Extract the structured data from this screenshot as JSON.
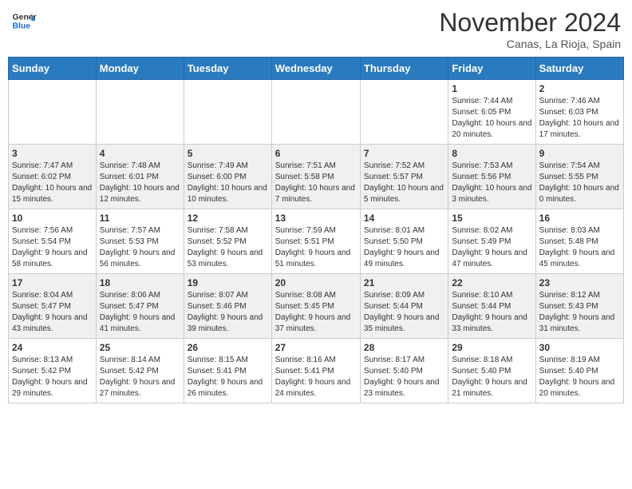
{
  "header": {
    "logo_line1": "General",
    "logo_line2": "Blue",
    "month_title": "November 2024",
    "location": "Canas, La Rioja, Spain"
  },
  "days_of_week": [
    "Sunday",
    "Monday",
    "Tuesday",
    "Wednesday",
    "Thursday",
    "Friday",
    "Saturday"
  ],
  "weeks": [
    [
      {
        "day": "",
        "info": ""
      },
      {
        "day": "",
        "info": ""
      },
      {
        "day": "",
        "info": ""
      },
      {
        "day": "",
        "info": ""
      },
      {
        "day": "",
        "info": ""
      },
      {
        "day": "1",
        "info": "Sunrise: 7:44 AM\nSunset: 6:05 PM\nDaylight: 10 hours and 20 minutes."
      },
      {
        "day": "2",
        "info": "Sunrise: 7:46 AM\nSunset: 6:03 PM\nDaylight: 10 hours and 17 minutes."
      }
    ],
    [
      {
        "day": "3",
        "info": "Sunrise: 7:47 AM\nSunset: 6:02 PM\nDaylight: 10 hours and 15 minutes."
      },
      {
        "day": "4",
        "info": "Sunrise: 7:48 AM\nSunset: 6:01 PM\nDaylight: 10 hours and 12 minutes."
      },
      {
        "day": "5",
        "info": "Sunrise: 7:49 AM\nSunset: 6:00 PM\nDaylight: 10 hours and 10 minutes."
      },
      {
        "day": "6",
        "info": "Sunrise: 7:51 AM\nSunset: 5:58 PM\nDaylight: 10 hours and 7 minutes."
      },
      {
        "day": "7",
        "info": "Sunrise: 7:52 AM\nSunset: 5:57 PM\nDaylight: 10 hours and 5 minutes."
      },
      {
        "day": "8",
        "info": "Sunrise: 7:53 AM\nSunset: 5:56 PM\nDaylight: 10 hours and 3 minutes."
      },
      {
        "day": "9",
        "info": "Sunrise: 7:54 AM\nSunset: 5:55 PM\nDaylight: 10 hours and 0 minutes."
      }
    ],
    [
      {
        "day": "10",
        "info": "Sunrise: 7:56 AM\nSunset: 5:54 PM\nDaylight: 9 hours and 58 minutes."
      },
      {
        "day": "11",
        "info": "Sunrise: 7:57 AM\nSunset: 5:53 PM\nDaylight: 9 hours and 56 minutes."
      },
      {
        "day": "12",
        "info": "Sunrise: 7:58 AM\nSunset: 5:52 PM\nDaylight: 9 hours and 53 minutes."
      },
      {
        "day": "13",
        "info": "Sunrise: 7:59 AM\nSunset: 5:51 PM\nDaylight: 9 hours and 51 minutes."
      },
      {
        "day": "14",
        "info": "Sunrise: 8:01 AM\nSunset: 5:50 PM\nDaylight: 9 hours and 49 minutes."
      },
      {
        "day": "15",
        "info": "Sunrise: 8:02 AM\nSunset: 5:49 PM\nDaylight: 9 hours and 47 minutes."
      },
      {
        "day": "16",
        "info": "Sunrise: 8:03 AM\nSunset: 5:48 PM\nDaylight: 9 hours and 45 minutes."
      }
    ],
    [
      {
        "day": "17",
        "info": "Sunrise: 8:04 AM\nSunset: 5:47 PM\nDaylight: 9 hours and 43 minutes."
      },
      {
        "day": "18",
        "info": "Sunrise: 8:06 AM\nSunset: 5:47 PM\nDaylight: 9 hours and 41 minutes."
      },
      {
        "day": "19",
        "info": "Sunrise: 8:07 AM\nSunset: 5:46 PM\nDaylight: 9 hours and 39 minutes."
      },
      {
        "day": "20",
        "info": "Sunrise: 8:08 AM\nSunset: 5:45 PM\nDaylight: 9 hours and 37 minutes."
      },
      {
        "day": "21",
        "info": "Sunrise: 8:09 AM\nSunset: 5:44 PM\nDaylight: 9 hours and 35 minutes."
      },
      {
        "day": "22",
        "info": "Sunrise: 8:10 AM\nSunset: 5:44 PM\nDaylight: 9 hours and 33 minutes."
      },
      {
        "day": "23",
        "info": "Sunrise: 8:12 AM\nSunset: 5:43 PM\nDaylight: 9 hours and 31 minutes."
      }
    ],
    [
      {
        "day": "24",
        "info": "Sunrise: 8:13 AM\nSunset: 5:42 PM\nDaylight: 9 hours and 29 minutes."
      },
      {
        "day": "25",
        "info": "Sunrise: 8:14 AM\nSunset: 5:42 PM\nDaylight: 9 hours and 27 minutes."
      },
      {
        "day": "26",
        "info": "Sunrise: 8:15 AM\nSunset: 5:41 PM\nDaylight: 9 hours and 26 minutes."
      },
      {
        "day": "27",
        "info": "Sunrise: 8:16 AM\nSunset: 5:41 PM\nDaylight: 9 hours and 24 minutes."
      },
      {
        "day": "28",
        "info": "Sunrise: 8:17 AM\nSunset: 5:40 PM\nDaylight: 9 hours and 23 minutes."
      },
      {
        "day": "29",
        "info": "Sunrise: 8:18 AM\nSunset: 5:40 PM\nDaylight: 9 hours and 21 minutes."
      },
      {
        "day": "30",
        "info": "Sunrise: 8:19 AM\nSunset: 5:40 PM\nDaylight: 9 hours and 20 minutes."
      }
    ]
  ]
}
